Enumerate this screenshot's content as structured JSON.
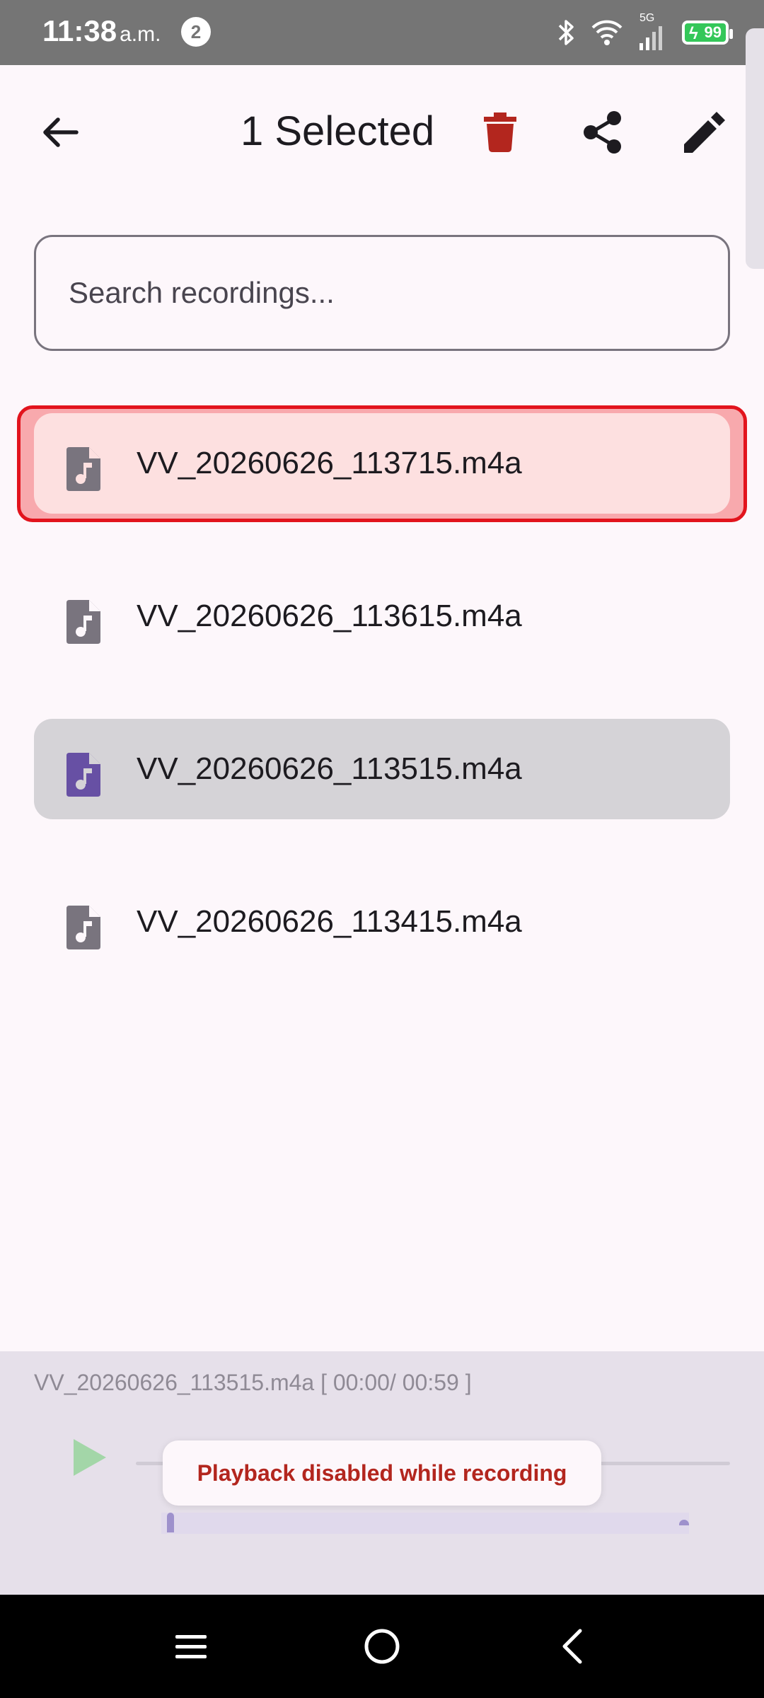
{
  "status_bar": {
    "time": "11:38",
    "ampm": "a.m.",
    "notification_count": "2",
    "network": "5G",
    "battery": "99"
  },
  "toolbar": {
    "title": "1 Selected",
    "icons": [
      "back-arrow-icon",
      "trash-icon",
      "share-icon",
      "pencil-icon"
    ],
    "delete_color": "#b3261e"
  },
  "search": {
    "placeholder": "Search recordings...",
    "value": ""
  },
  "recordings": [
    {
      "name": "VV_20260626_113715.m4a",
      "state": "selected"
    },
    {
      "name": "VV_20260626_113615.m4a",
      "state": "normal"
    },
    {
      "name": "VV_20260626_113515.m4a",
      "state": "playing"
    },
    {
      "name": "VV_20260626_113415.m4a",
      "state": "normal"
    }
  ],
  "player": {
    "now_playing": "VV_20260626_113515.m4a [ 00:00/ 00:59 ]",
    "toast": "Playback disabled while recording"
  },
  "colors": {
    "selected_outline": "#e2141d",
    "selected_fill": "#fde0e0",
    "playing_fill": "#d5d3d7",
    "accent_icon": "#6750a4"
  }
}
